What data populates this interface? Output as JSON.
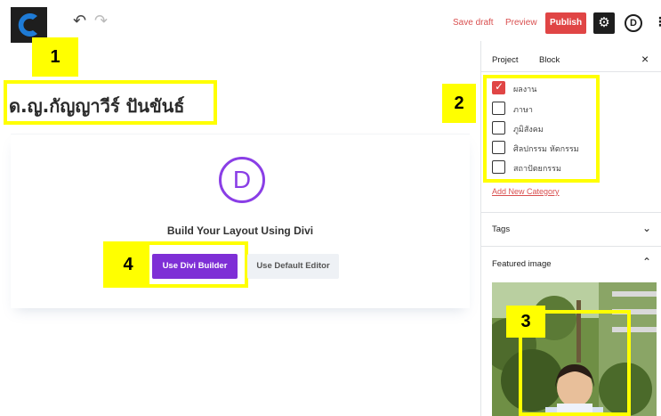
{
  "toolbar": {
    "undo_icon": "↶",
    "redo_icon": "↷",
    "save_draft": "Save draft",
    "preview": "Preview",
    "publish": "Publish",
    "settings_icon": "⚙",
    "divi_icon": "D",
    "more_icon": "⋮"
  },
  "post": {
    "title": "ด.ญ.กัญญาวีร์ ปันขันธ์"
  },
  "divi": {
    "logo_letter": "D",
    "heading": "Build Your Layout Using Divi",
    "use_divi_builder": "Use Divi Builder",
    "use_default_editor": "Use Default Editor"
  },
  "sidebar": {
    "tab_project": "Project",
    "tab_block": "Block",
    "close_icon": "×",
    "categories": [
      {
        "label": "ผลงาน",
        "checked": true
      },
      {
        "label": "ภาษา",
        "checked": false
      },
      {
        "label": "ภูมิสังคม",
        "checked": false
      },
      {
        "label": "ศิลปกรรม หัตกรรม",
        "checked": false
      },
      {
        "label": "สถาปัตยกรรม",
        "checked": false
      }
    ],
    "add_new_category": "Add New Category",
    "tags_label": "Tags",
    "featured_image_label": "Featured image",
    "chevron_down": "⌄",
    "chevron_up": "⌃"
  },
  "callouts": [
    "1",
    "2",
    "3",
    "4"
  ],
  "colors": {
    "accent_red": "#e04545",
    "divi_purple": "#7e2fd6",
    "highlight_yellow": "#ffff00"
  }
}
